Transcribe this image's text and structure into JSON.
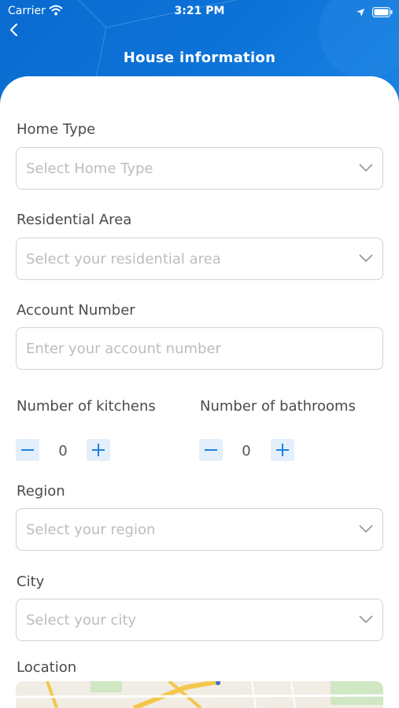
{
  "status_bar": {
    "carrier": "Carrier",
    "time": "3:21 PM"
  },
  "header": {
    "title": "House information"
  },
  "form": {
    "home_type": {
      "label": "Home Type",
      "placeholder": "Select Home Type"
    },
    "residential_area": {
      "label": "Residential Area",
      "placeholder": "Select your residential area"
    },
    "account_number": {
      "label": "Account Number",
      "placeholder": "Enter your account number"
    },
    "kitchens": {
      "label": "Number of kitchens",
      "value": "0"
    },
    "bathrooms": {
      "label": "Number of bathrooms",
      "value": "0"
    },
    "region": {
      "label": "Region",
      "placeholder": "Select your region"
    },
    "city": {
      "label": "City",
      "placeholder": "Select your city"
    },
    "location": {
      "label": "Location"
    }
  },
  "colors": {
    "brand": "#0d73d8",
    "stepper_bg": "#e3effb",
    "stepper_icon": "#1f7fe0"
  }
}
